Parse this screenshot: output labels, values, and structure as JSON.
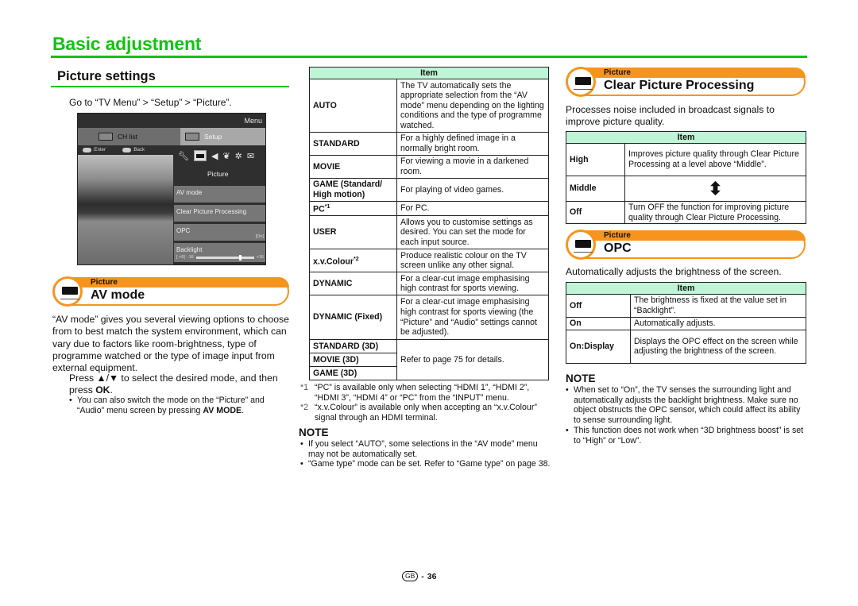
{
  "page": {
    "title": "Basic adjustment",
    "section_title": "Picture settings",
    "goto": "Go to “TV Menu” > “Setup” > “Picture”.",
    "footer": {
      "region": "GB",
      "separator": "-",
      "page_number": "36"
    }
  },
  "tv_menu": {
    "menu_label": "Menu",
    "tabs": [
      {
        "label": "CH list"
      },
      {
        "label": "Setup"
      }
    ],
    "hints": [
      {
        "key": "OK",
        "label": ":Enter"
      },
      {
        "key": "RETURN",
        "label": ":Back"
      }
    ],
    "icons": [
      "wrench-icon",
      "picture-icon",
      "audio-icon",
      "eco-icon",
      "gear-icon",
      "mail-icon"
    ],
    "category_label": "Picture",
    "items": [
      {
        "label": "AV mode"
      },
      {
        "label": "Clear Picture Processing"
      },
      {
        "label": "OPC",
        "value": "[On]"
      },
      {
        "label": "Backlight",
        "bracket": "[ +8]",
        "min": "-16",
        "max": "+16",
        "value": 8,
        "range": [
          -16,
          16
        ]
      }
    ]
  },
  "av_mode": {
    "banner_sub": "Picture",
    "banner_title": "AV mode",
    "description": "“AV mode” gives you several viewing options to choose from to best match the system environment, which can vary due to factors like room-brightness, type of programme watched or the type of image input from external equipment.",
    "instruction_pre": "Press ▲/▼ to select the desired mode, and then press ",
    "instruction_key": "OK",
    "instruction_post": ".",
    "bullet_pre": "You can also switch the mode on the “Picture” and “Audio” menu screen by pressing ",
    "bullet_key": "AV MODE",
    "bullet_post": ".",
    "table": {
      "header": "Item",
      "rows": [
        {
          "item": "AUTO",
          "desc": "The TV automatically sets the appropriate selection from the “AV mode” menu depending on the lighting conditions and the type of programme watched."
        },
        {
          "item": "STANDARD",
          "desc": "For a highly defined image in a normally bright room."
        },
        {
          "item": "MOVIE",
          "desc": "For viewing a movie in a darkened room."
        },
        {
          "item": "GAME (Standard/ High motion)",
          "desc": "For playing of video games."
        },
        {
          "item": "PC",
          "sup": "*1",
          "desc": "For PC."
        },
        {
          "item": "USER",
          "desc": "Allows you to customise settings as desired. You can set the mode for each input source."
        },
        {
          "item": "x.v.Colour",
          "sup": "*2",
          "desc": "Produce realistic colour on the TV screen unlike any other signal."
        },
        {
          "item": "DYNAMIC",
          "desc": "For a clear-cut image emphasising high contrast for sports viewing."
        },
        {
          "item": "DYNAMIC (Fixed)",
          "desc": "For a clear-cut image emphasising high contrast for sports viewing (the “Picture” and “Audio” settings cannot be adjusted)."
        }
      ],
      "group_3d": {
        "items": [
          "STANDARD (3D)",
          "MOVIE (3D)",
          "GAME (3D)"
        ],
        "desc": "Refer to page 75 for details."
      }
    },
    "footnotes": [
      {
        "mark": "*1",
        "text": "“PC” is available only when selecting “HDMI 1”, “HDMI 2”, “HDMI 3”, “HDMI 4” or “PC” from the “INPUT” menu."
      },
      {
        "mark": "*2",
        "text": "“x.v.Colour” is available only when accepting an “x.v.Colour” signal through an HDMI terminal."
      }
    ],
    "note_title": "NOTE",
    "notes": [
      "If you select “AUTO”, some selections in the “AV mode” menu may not be automatically set.",
      "“Game type” mode can be set. Refer to “Game type” on page 38."
    ]
  },
  "clear_picture": {
    "banner_sub": "Picture",
    "banner_title": "Clear Picture Processing",
    "description": "Processes noise included in broadcast signals to improve picture quality.",
    "table": {
      "header": "Item",
      "rows": [
        {
          "item": "High",
          "desc": "Improves picture quality through Clear Picture Processing at a level above “Middle”."
        },
        {
          "item": "Middle",
          "desc": "",
          "icon": "up-down-arrow-icon"
        },
        {
          "item": "Off",
          "desc": "Turn OFF the function for improving picture quality through Clear Picture Processing."
        }
      ]
    }
  },
  "opc": {
    "banner_sub": "Picture",
    "banner_title": "OPC",
    "description": "Automatically adjusts the brightness of the screen.",
    "table": {
      "header": "Item",
      "rows": [
        {
          "item": "Off",
          "desc": "The brightness is fixed at the value set in “Backlight”."
        },
        {
          "item": "On",
          "desc": "Automatically adjusts."
        },
        {
          "item": "On:Display",
          "desc": "Displays the OPC effect on the screen while adjusting the brightness of the screen."
        }
      ]
    },
    "note_title": "NOTE",
    "notes": [
      "When set to “On”, the TV senses the surrounding light and automatically adjusts the backlight brightness. Make sure no object obstructs the OPC sensor, which could affect its ability to sense surrounding light.",
      "This function does not work when “3D brightness boost” is set to “High” or “Low”."
    ]
  },
  "colors": {
    "heading_green": "#14c214",
    "banner_orange": "#f7941d",
    "table_header": "#bff5d6"
  }
}
